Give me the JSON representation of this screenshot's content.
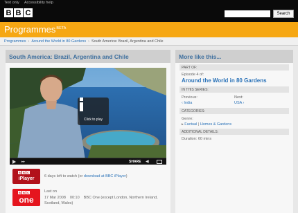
{
  "utility": {
    "text_only": "Text only",
    "accessibility": "Accessibility help"
  },
  "logo": [
    "B",
    "B",
    "C"
  ],
  "search": {
    "button": "Search",
    "placeholder": ""
  },
  "banner": {
    "title": "Programmes",
    "beta": "BETA"
  },
  "breadcrumb": {
    "items": [
      "Programmes",
      "Around the World in 80 Gardens",
      "South America: Brazil, Argentina and Chile"
    ]
  },
  "main": {
    "title": "South America: Brazil, Argentina and Chile",
    "player": {
      "play_label": "Click to play",
      "share_label": "SHARE"
    },
    "iplayer": {
      "badge_logo": "BBC",
      "badge_name": "iPlayer",
      "days_left": "6 days left to watch",
      "open_paren": "(or ",
      "download_link": "download at BBC iPlayer",
      "close_paren": ")"
    },
    "broadcast": {
      "badge_logo": "BBC",
      "badge_name": "one",
      "last_on_label": "Last on",
      "date": "17 Mar 2008",
      "time": "00:10",
      "channel": "BBC One (except London, Northern Ireland, Scotland, Wales)"
    }
  },
  "side": {
    "title": "More like this...",
    "part_of_label": "PART OF:",
    "episode_text": "Episode 4 of:",
    "series_title": "Around the World in 80 Gardens",
    "in_series_label": "IN THIS SERIES:",
    "previous_label": "Previous:",
    "previous_link": "‹ India",
    "next_label": "Next:",
    "next_link": "USA ›",
    "categories_label": "CATEGORIES:",
    "genre_label": "Genre:",
    "genre_arrow": "▸",
    "genre_factual": "Factual",
    "genre_sep": "|",
    "genre_homes": "Homes & Gardens",
    "additional_label": "ADDITIONAL DETAILS:",
    "duration": "Duration: 60 mins"
  },
  "colors": {
    "banner": "#f6a713",
    "link": "#2a72b8",
    "heading": "#3e6f9e",
    "iplayer": "#b2111a",
    "bbc_one": "#e5151e"
  },
  "icons": [
    "play-icon",
    "info-icon",
    "volume-icon",
    "fullscreen-icon",
    "fast-forward-icon"
  ]
}
